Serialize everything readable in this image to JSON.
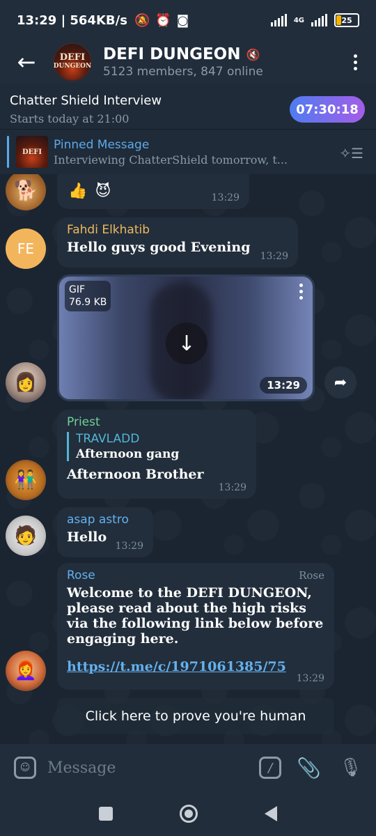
{
  "status_bar": {
    "time": "13:29",
    "speed": "564KB/s",
    "network": "4G",
    "battery": "25"
  },
  "header": {
    "title": "DEFI DUNGEON",
    "subtitle": "5123 members, 847 online",
    "avatar_text_line1": "DEFI",
    "avatar_text_line2": "DUNGEON"
  },
  "live": {
    "title": "Chatter Shield Interview",
    "subtitle": "Starts today at 21:00",
    "timer": "07:30:18"
  },
  "pinned": {
    "title": "Pinned Message",
    "text": "Interviewing ChatterShield tomorrow, t..."
  },
  "messages": {
    "reactions": {
      "time": "13:29"
    },
    "fahdi": {
      "initials": "FE",
      "sender": "Fahdi Elkhatib",
      "text": "Hello guys good Evening",
      "time": "13:29"
    },
    "gif": {
      "label": "GIF",
      "size": "76.9 KB",
      "time": "13:29"
    },
    "priest": {
      "sender": "Priest",
      "reply_name": "TRAVLADD",
      "reply_text": "Afternoon gang",
      "text": "Afternoon Brother",
      "time": "13:29"
    },
    "asap": {
      "sender": "asap astro",
      "text": "Hello",
      "time": "13:29"
    },
    "rose": {
      "sender": "Rose",
      "tag": "Rose",
      "text": "Welcome to the DEFI DUNGEON, please read about the high risks via the following link below before engaging here.",
      "link": "https://t.me/c/1971061385/75",
      "time": "13:29"
    }
  },
  "bot_button": "Click here to prove you're human",
  "input": {
    "placeholder": "Message"
  },
  "colors": {
    "accent": "#5ea9ea",
    "fahdi_name": "#f0b860",
    "priest_name": "#6fd19a",
    "asap_name": "#64b1ef",
    "rose_name": "#64b1ef"
  }
}
